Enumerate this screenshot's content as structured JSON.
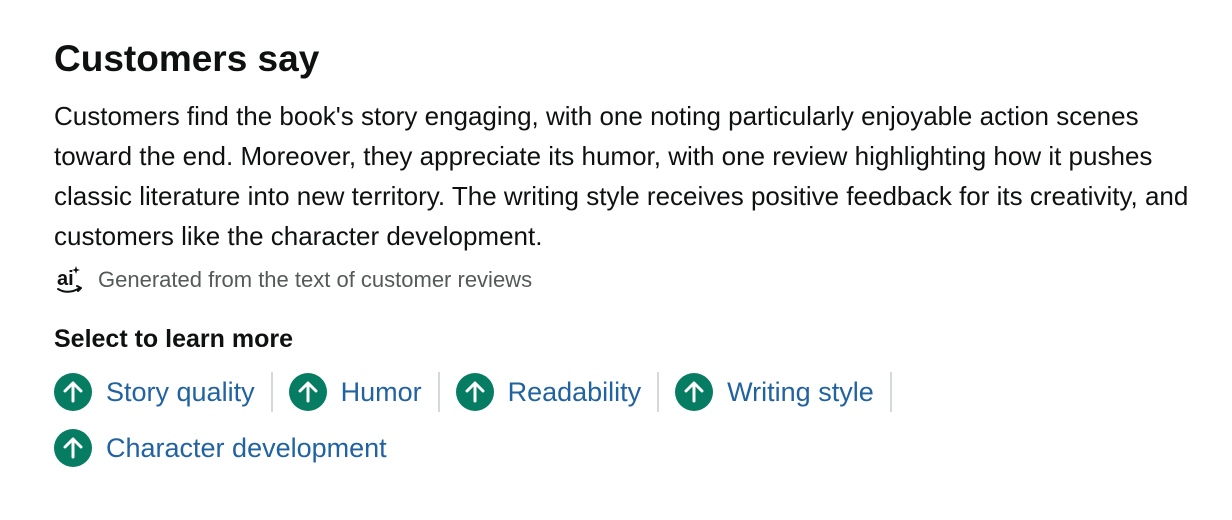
{
  "header": {
    "title": "Customers say"
  },
  "summary": {
    "text": "Customers find the book's story engaging, with one noting particularly enjoyable action scenes toward the end. Moreover, they appreciate its humor, with one review highlighting how it pushes classic literature into new territory. The writing style receives positive feedback for its creativity, and customers like the character development."
  },
  "ai_note": {
    "icon": "ai-sparkle-icon",
    "text": "Generated from the text of customer reviews"
  },
  "learn_more": {
    "heading": "Select to learn more",
    "aspects": [
      {
        "label": "Story quality",
        "sentiment": "positive",
        "icon": "arrow-up-icon"
      },
      {
        "label": "Humor",
        "sentiment": "positive",
        "icon": "arrow-up-icon"
      },
      {
        "label": "Readability",
        "sentiment": "positive",
        "icon": "arrow-up-icon"
      },
      {
        "label": "Writing style",
        "sentiment": "positive",
        "icon": "arrow-up-icon"
      },
      {
        "label": "Character development",
        "sentiment": "positive",
        "icon": "arrow-up-icon"
      }
    ]
  },
  "colors": {
    "positive": "#067d62",
    "link": "#2162a1",
    "muted": "#565959"
  }
}
